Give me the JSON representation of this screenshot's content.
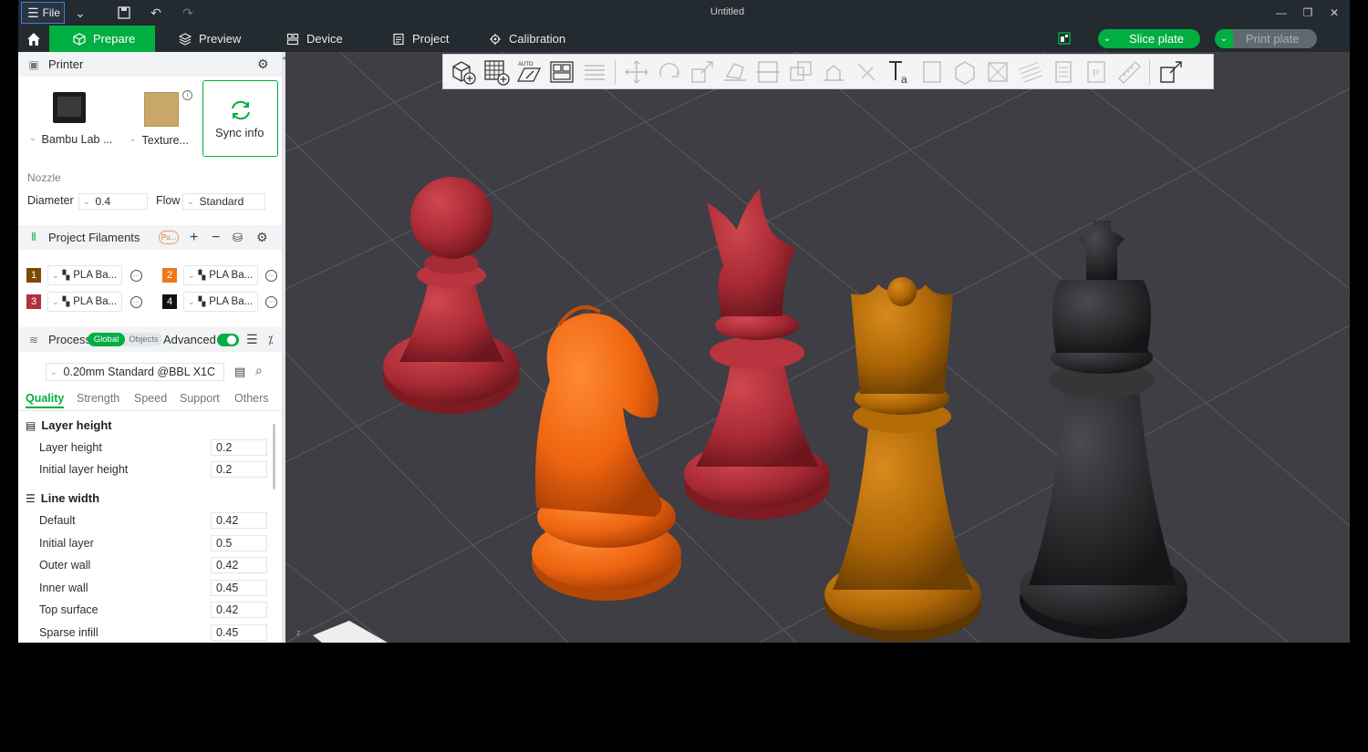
{
  "titlebar": {
    "file_label": "File",
    "title": "Untitled"
  },
  "toolbar": {
    "tabs": [
      {
        "label": "Prepare",
        "icon": "cube-icon",
        "active": true
      },
      {
        "label": "Preview",
        "icon": "layers-icon",
        "active": false
      },
      {
        "label": "Device",
        "icon": "device-icon",
        "active": false
      },
      {
        "label": "Project",
        "icon": "document-icon",
        "active": false
      },
      {
        "label": "Calibration",
        "icon": "calibration-icon",
        "active": false
      }
    ],
    "slice_label": "Slice plate",
    "print_label": "Print plate"
  },
  "printer": {
    "header": "Printer",
    "printer_name": "Bambu Lab ...",
    "plate_name": "Texture...",
    "sync_label": "Sync info",
    "nozzle_label": "Nozzle",
    "diameter_label": "Diameter",
    "diameter_value": "0.4",
    "flow_label": "Flow",
    "flow_value": "Standard"
  },
  "filaments": {
    "header": "Project Filaments",
    "badge": "Pu...",
    "items": [
      {
        "num": "1",
        "color": "#7a4a06",
        "name": "PLA Ba..."
      },
      {
        "num": "2",
        "color": "#f2771a",
        "name": "PLA Ba..."
      },
      {
        "num": "3",
        "color": "#b2313a",
        "name": "PLA Ba..."
      },
      {
        "num": "4",
        "color": "#111111",
        "name": "PLA Ba..."
      }
    ]
  },
  "process": {
    "header": "Process",
    "global_label": "Global",
    "objects_label": "Objects",
    "advanced_label": "Advanced",
    "preset": "0.20mm Standard @BBL X1C",
    "tabs": [
      "Quality",
      "Strength",
      "Speed",
      "Support",
      "Others"
    ],
    "groups": [
      {
        "title": "Layer height",
        "rows": [
          {
            "label": "Layer height",
            "value": "0.2"
          },
          {
            "label": "Initial layer height",
            "value": "0.2"
          }
        ]
      },
      {
        "title": "Line width",
        "rows": [
          {
            "label": "Default",
            "value": "0.42"
          },
          {
            "label": "Initial layer",
            "value": "0.5"
          },
          {
            "label": "Outer wall",
            "value": "0.42"
          },
          {
            "label": "Inner wall",
            "value": "0.45"
          },
          {
            "label": "Top surface",
            "value": "0.42"
          },
          {
            "label": "Sparse infill",
            "value": "0.45"
          }
        ]
      }
    ]
  },
  "viewport": {
    "axis_label": "z",
    "pieces": [
      {
        "name": "pawn",
        "color": "#b0303a"
      },
      {
        "name": "knight",
        "color": "#f56a10"
      },
      {
        "name": "bishop",
        "color": "#b0303a"
      },
      {
        "name": "queen",
        "color": "#b56b06"
      },
      {
        "name": "king",
        "color": "#2c2c2f"
      }
    ]
  }
}
